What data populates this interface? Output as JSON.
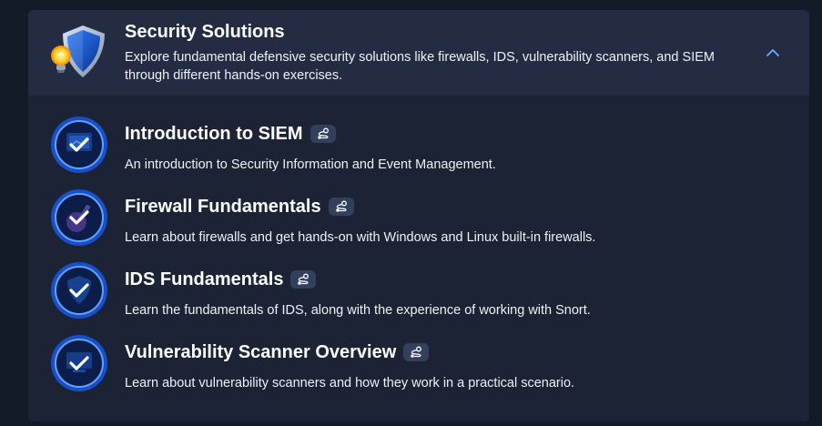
{
  "module": {
    "title": "Security Solutions",
    "description": "Explore fundamental defensive security solutions like firewalls, IDS, vulnerability scanners, and SIEM through different hands-on exercises.",
    "icon": "shield-lightbulb-icon",
    "expanded": true
  },
  "rooms": [
    {
      "title": "Introduction to SIEM",
      "description": "An introduction to Security Information and Event Management.",
      "completed": true,
      "tag_icon": "path-icon"
    },
    {
      "title": "Firewall Fundamentals",
      "description": "Learn about firewalls and get hands-on with Windows and Linux built-in firewalls.",
      "completed": true,
      "tag_icon": "path-icon"
    },
    {
      "title": "IDS Fundamentals",
      "description": "Learn the fundamentals of IDS, along with the experience of working with Snort.",
      "completed": true,
      "tag_icon": "path-icon"
    },
    {
      "title": "Vulnerability Scanner Overview",
      "description": "Learn about vulnerability scanners and how they work in a practical scenario.",
      "completed": true,
      "tag_icon": "path-icon"
    }
  ],
  "colors": {
    "page_bg": "#131a28",
    "card_bg": "#1b2335",
    "header_bg": "#232c42",
    "badge_ring": "#3f8cff",
    "check": "#ffffff",
    "accent": "#6ea8ff"
  }
}
